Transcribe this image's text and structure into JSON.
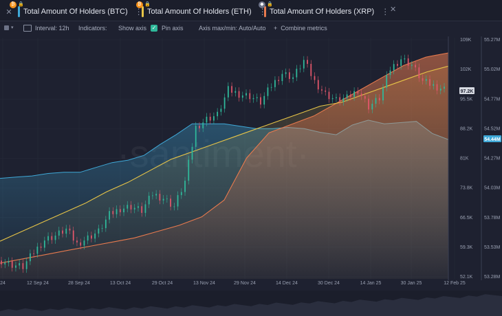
{
  "tabs": [
    {
      "label": "Total Amount Of Holders (BTC)",
      "color": "#3fa9d8",
      "badge_icon": "bitcoin-icon",
      "badge_color": "#f7931a"
    },
    {
      "label": "Total Amount Of Holders (ETH)",
      "color": "#e8c547",
      "badge_icon": "bitcoin-icon",
      "badge_color": "#f7931a"
    },
    {
      "label": "Total Amount Of Holders (XRP)",
      "color": "#e87a4e",
      "badge_icon": "ethereum-icon",
      "badge_color": "#6c7287"
    }
  ],
  "toolbar": {
    "interval": "Interval: 12h",
    "indicators": "Indicators:",
    "show_axis": "Show axis",
    "pin_axis": "Pin axis",
    "axis_maxmin": "Axis max/min: Auto/Auto",
    "combine": "Combine metrics"
  },
  "watermark": "·santiment·",
  "colors": {
    "btc": "#3fa9d8",
    "eth": "#e8c547",
    "xrp": "#e87a4e",
    "price": "#2fb89a",
    "price_down": "#e0566a"
  },
  "chart_data": {
    "type": "line",
    "x_ticks": [
      "24",
      "12 Sep 24",
      "28 Sep 24",
      "13 Oct 24",
      "29 Oct 24",
      "13 Nov 24",
      "29 Nov 24",
      "14 Dec 24",
      "30 Dec 24",
      "14 Jan 25",
      "30 Jan 25",
      "12 Feb 25"
    ],
    "y_left_ticks": [
      "109K",
      "102K",
      "95.5K",
      "88.2K",
      "81K",
      "73.8K",
      "66.5K",
      "59.3K",
      "52.1K"
    ],
    "y_left_range": [
      52100,
      109000
    ],
    "y_right_ticks": [
      "55.27M",
      "55.02M",
      "54.77M",
      "54.52M",
      "54.27M",
      "54.03M",
      "53.78M",
      "53.53M",
      "53.28M"
    ],
    "y_right_range": [
      53280000,
      55270000
    ],
    "price_label": "97.2K",
    "btc_holders_label": "54.44M",
    "series": [
      {
        "name": "Total Amount Of Holders (BTC)",
        "values": [
          54.11,
          54.12,
          54.13,
          54.15,
          54.16,
          54.16,
          54.2,
          54.24,
          54.26,
          54.3,
          54.39,
          54.47,
          54.56,
          54.56,
          54.56,
          54.54,
          54.52,
          54.52,
          54.53,
          54.52,
          54.49,
          54.47,
          54.55,
          54.59,
          54.56,
          54.57,
          54.58,
          54.48,
          54.43
        ]
      },
      {
        "name": "Total Amount Of Holders (ETH)",
        "values": [
          0.05,
          0.1,
          0.15,
          0.2,
          0.25,
          0.31,
          0.36,
          0.42,
          0.48,
          0.52,
          0.56,
          0.6,
          0.64,
          0.68,
          0.72,
          0.76,
          0.78,
          0.82,
          0.86,
          0.9,
          0.94,
          0.97
        ]
      },
      {
        "name": "Total Amount Of Holders (XRP)",
        "values": [
          0.0,
          0.02,
          0.04,
          0.06,
          0.08,
          0.1,
          0.12,
          0.15,
          0.18,
          0.22,
          0.3,
          0.5,
          0.62,
          0.66,
          0.7,
          0.76,
          0.82,
          0.88,
          0.94,
          0.98,
          1.0
        ]
      },
      {
        "name": "Price",
        "values": [
          56000,
          55000,
          54500,
          58000,
          61000,
          62000,
          63500,
          60000,
          61500,
          63000,
          67000,
          68500,
          69000,
          68000,
          72000,
          71000,
          69000,
          75000,
          88000,
          90000,
          91000,
          97000,
          96000,
          95500,
          94000,
          98000,
          101000,
          100000,
          104000,
          99000,
          96000,
          94500,
          95000,
          97000,
          93000,
          95000,
          102000,
          104500,
          103000,
          99000,
          98000,
          97200
        ]
      }
    ]
  }
}
